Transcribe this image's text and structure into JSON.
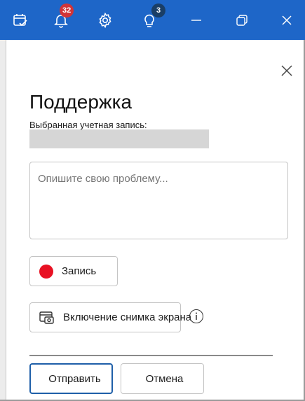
{
  "titlebar": {
    "icons": [
      "calendar-check-icon",
      "bell-icon",
      "gear-icon",
      "lightbulb-icon",
      "minimize-icon",
      "restore-icon",
      "close-icon"
    ],
    "notifications_count": "32",
    "tips_count": "3",
    "accent": "#1e66c8"
  },
  "support": {
    "title": "Поддержка",
    "account_label": "Выбранная учетная запись:",
    "account_value": "",
    "description_placeholder": "Опишите свою проблему...",
    "record_label": "Запись",
    "screenshot_label": "Включение снимка экрана",
    "send_label": "Отправить",
    "cancel_label": "Отмена"
  }
}
